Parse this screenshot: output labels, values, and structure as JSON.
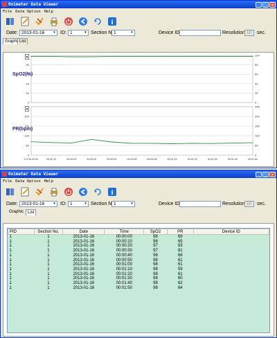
{
  "window": {
    "title": "Oximeter Data Viewer"
  },
  "menu": [
    "File",
    "Data Option",
    "Help"
  ],
  "toolbar": {
    "icons": [
      "open-file-icon",
      "edit-icon",
      "check-icon",
      "print-icon",
      "power-icon",
      "back-icon",
      "refresh-icon",
      "info-icon"
    ]
  },
  "filters": {
    "date_label": "Date:",
    "date_value": "2013-01-16",
    "id_label": "ID:",
    "id_value": "1",
    "section_label": "Section No.:",
    "section_value": "1",
    "device_label": "Device ID",
    "device_value": "",
    "resolution_label": "Resolution:",
    "resolution_value": "10",
    "resolution_unit": "sec."
  },
  "tabs": {
    "graphic": "Graphic",
    "list": "List"
  },
  "graph": {
    "spo2_label": "SpO2(%)",
    "pr_label": "PR(bpm)",
    "spo2_left_ticks": [
      "100",
      "80",
      "60",
      "40",
      "20",
      "0"
    ],
    "spo2_right_ticks": [
      "100",
      "80",
      "60",
      "40",
      "20",
      "0"
    ],
    "pr_left_ticks": [
      "250",
      "200",
      "150",
      "100",
      "50",
      "0"
    ],
    "pr_right_ticks": [
      "250",
      "200",
      "150",
      "100",
      "50",
      "0"
    ],
    "x_ticks": [
      "0.0 00:00:00",
      "00:00:10",
      "00:00:20",
      "00:00:30",
      "00:00:40",
      "00:00:50",
      "00:01:00",
      "00:01:10",
      "00:01:20",
      "00:01:30",
      "00:01:40",
      "00:01:50"
    ]
  },
  "chart_data": {
    "type": "line",
    "x": [
      "00:00:00",
      "00:00:10",
      "00:00:20",
      "00:00:30",
      "00:00:40",
      "00:00:50",
      "00:01:00",
      "00:01:10",
      "00:01:20",
      "00:01:30",
      "00:01:40",
      "00:01:50"
    ],
    "series": [
      {
        "name": "SpO2(%)",
        "values": [
          98,
          98,
          97,
          97,
          98,
          98,
          98,
          98,
          98,
          98,
          98,
          98
        ]
      },
      {
        "name": "PR(bpm)",
        "values": [
          69,
          65,
          63,
          81,
          68,
          61,
          61,
          59,
          61,
          60,
          62,
          64
        ]
      }
    ],
    "spo2_ylim": [
      0,
      100
    ],
    "pr_ylim": [
      0,
      250
    ],
    "colors": {
      "line": "#2e8b3c",
      "grid": "#c8c8c8"
    }
  },
  "table": {
    "headers": [
      "PID",
      "Section No.",
      "Date",
      "Time",
      "SpO2",
      "PR",
      "Device ID"
    ],
    "rows": [
      [
        "1",
        "1",
        "2013-01-16",
        "00:00:00",
        "98",
        "69",
        ""
      ],
      [
        "1",
        "1",
        "2013-01-16",
        "00:00:10",
        "98",
        "65",
        ""
      ],
      [
        "1",
        "1",
        "2013-01-16",
        "00:00:20",
        "97",
        "63",
        ""
      ],
      [
        "1",
        "1",
        "2013-01-16",
        "00:00:30",
        "97",
        "81",
        ""
      ],
      [
        "1",
        "1",
        "2013-01-16",
        "00:00:40",
        "98",
        "68",
        ""
      ],
      [
        "1",
        "1",
        "2013-01-16",
        "00:00:50",
        "98",
        "61",
        ""
      ],
      [
        "1",
        "1",
        "2013-01-16",
        "00:01:00",
        "98",
        "61",
        ""
      ],
      [
        "1",
        "1",
        "2013-01-16",
        "00:01:10",
        "98",
        "59",
        ""
      ],
      [
        "1",
        "1",
        "2013-01-16",
        "00:01:20",
        "98",
        "61",
        ""
      ],
      [
        "1",
        "1",
        "2013-01-16",
        "00:01:30",
        "98",
        "60",
        ""
      ],
      [
        "1",
        "1",
        "2013-01-16",
        "00:01:40",
        "98",
        "62",
        ""
      ],
      [
        "1",
        "1",
        "2013-01-16",
        "00:01:50",
        "98",
        "64",
        ""
      ]
    ],
    "row_bg": "#c5ead8"
  },
  "colors": {
    "titlebar": "#0a3fc6",
    "panel": "#ece9d8",
    "axis_label": "#1f1f8f"
  }
}
